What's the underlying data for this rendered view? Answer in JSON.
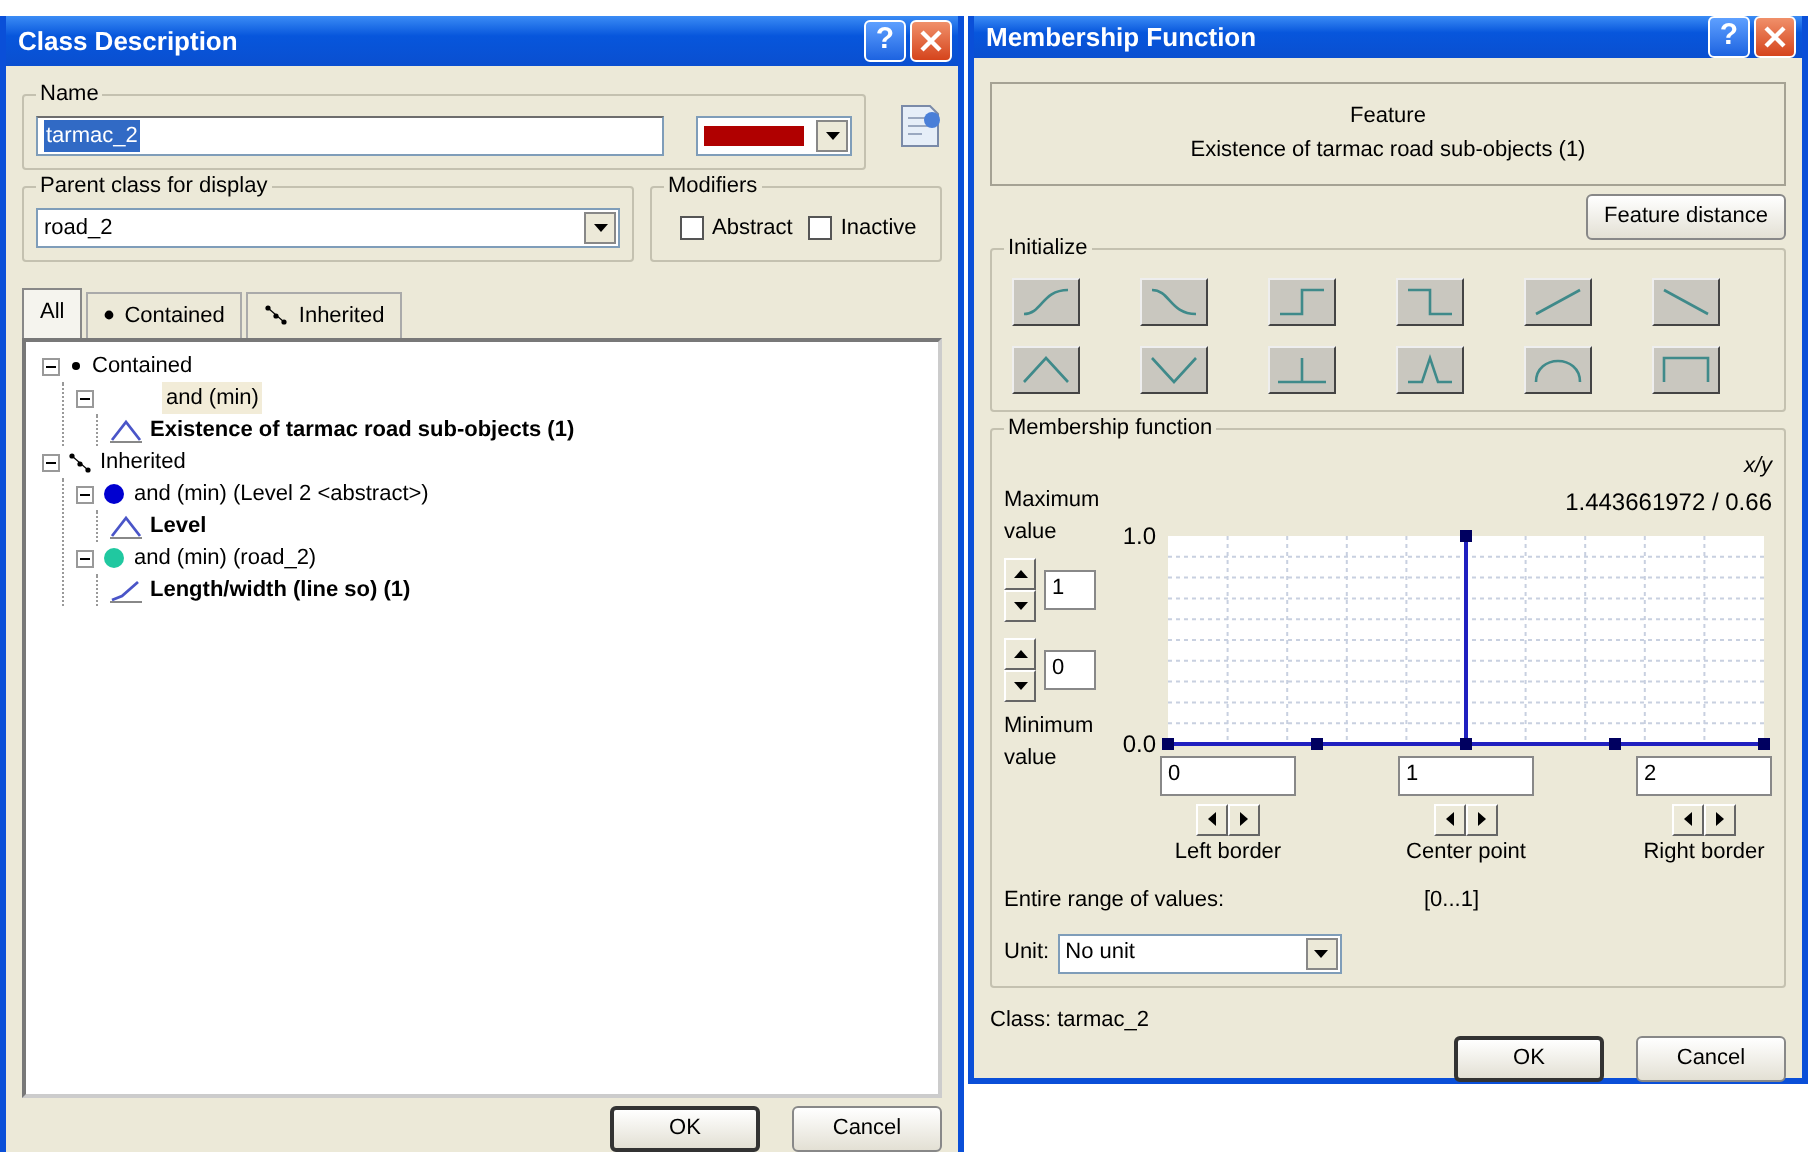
{
  "class_window": {
    "title": "Class Description",
    "help_button": "?",
    "name_group": {
      "label": "Name",
      "value": "tarmac_2",
      "value_selected": true,
      "color": "#b00000"
    },
    "parent_group": {
      "label": "Parent class for display",
      "value": "road_2"
    },
    "modifiers": {
      "label": "Modifiers",
      "options": [
        {
          "label": "Abstract",
          "checked": false
        },
        {
          "label": "Inactive",
          "checked": false
        }
      ]
    },
    "tabs": [
      {
        "label": "All",
        "kind": "all",
        "selected": true
      },
      {
        "label": "Contained",
        "kind": "contained",
        "selected": false
      },
      {
        "label": "Inherited",
        "kind": "inherited",
        "selected": false
      }
    ],
    "tree": [
      {
        "label": "Contained",
        "kind": "contained",
        "expanded": true,
        "selected": false,
        "children": [
          {
            "label": "and (min)",
            "kind": "operator",
            "expanded": true,
            "selected": true,
            "children": [
              {
                "label": "Existence of tarmac road sub-objects  (1)",
                "kind": "triangle",
                "selected": false
              }
            ]
          }
        ]
      },
      {
        "label": "Inherited",
        "kind": "inherited",
        "expanded": true,
        "selected": false,
        "children": [
          {
            "label": "and (min) (Level 2 <abstract>)",
            "kind": "class",
            "color": "#0000d0",
            "expanded": true,
            "selected": false,
            "children": [
              {
                "label": "Level",
                "kind": "triangle",
                "selected": false
              }
            ]
          },
          {
            "label": "and (min) (road_2)",
            "kind": "class",
            "color": "#20c8a0",
            "expanded": true,
            "selected": false,
            "children": [
              {
                "label": "Length/width (line so)  (1)",
                "kind": "ramp",
                "selected": false
              }
            ]
          }
        ]
      }
    ],
    "buttons": [
      {
        "label": "OK",
        "default": true
      },
      {
        "label": "Cancel",
        "default": false
      }
    ]
  },
  "membership_window": {
    "title": "Membership Function",
    "help_button": "?",
    "feature": {
      "heading": "Feature",
      "name": "Existence of tarmac road sub-objects  (1)"
    },
    "feature_distance_button": "Feature distance",
    "initialize": {
      "label": "Initialize"
    },
    "function_group": {
      "label": "Membership function",
      "xy_label": "x/y",
      "readout": "1.443661972 / 0.66",
      "maximum": {
        "label": "Maximum value",
        "value": "1"
      },
      "minimum": {
        "label": "Minimum value",
        "value": "0"
      },
      "plot": {
        "kind": "spike",
        "y_max_label": "1.0",
        "y_min_label": "0.0"
      },
      "borders": [
        {
          "value": "0",
          "label": "Left border"
        },
        {
          "value": "1",
          "label": "Center point"
        },
        {
          "value": "2",
          "label": "Right border"
        }
      ],
      "range_label": "Entire range of values:",
      "range_value": "[0...1]",
      "unit_label": "Unit:",
      "unit_value": "No unit"
    },
    "class_line": "Class: tarmac_2",
    "buttons": [
      {
        "label": "OK",
        "default": true
      },
      {
        "label": "Cancel",
        "default": false
      }
    ]
  }
}
